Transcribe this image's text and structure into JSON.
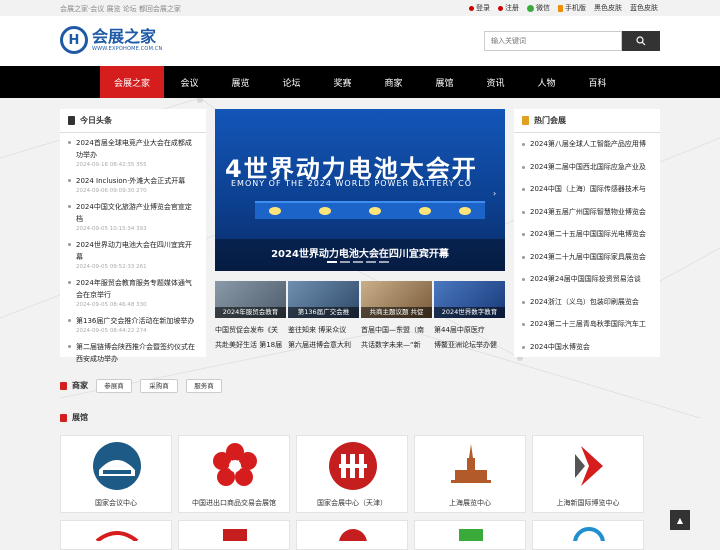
{
  "topbar": {
    "links": "会展之家·会议 展览 论坛 都回会展之家",
    "login": "登录",
    "register": "注册",
    "wechat": "微信",
    "mobile": "手机版",
    "black_skin": "黑色皮肤",
    "blue_skin": "蓝色皮肤"
  },
  "logo": {
    "cn": "会展之家",
    "en": "WWW.EXPOHOME.COM.CN",
    "mark": "H"
  },
  "search": {
    "placeholder": "输入关键词"
  },
  "nav": [
    "会展之家",
    "会议",
    "展览",
    "论坛",
    "奖赛",
    "商家",
    "展馆",
    "资讯",
    "人物",
    "百科"
  ],
  "news": {
    "title": "今日头条",
    "items": [
      {
        "t": "2024首届全球电竞产业大会在成都成功举办",
        "d": "2024-09-16 08:42:35    355"
      },
      {
        "t": "2024 Inclusion·外滩大会正式开幕",
        "d": "2024-09-06 09:09:30    270"
      },
      {
        "t": "2024中国文化旅游产业博览会官宣定档",
        "d": "2024-09-05 10:15:34    393"
      },
      {
        "t": "2024世界动力电池大会在四川宜宾开幕",
        "d": "2024-09-05 09:52:33    261"
      },
      {
        "t": "2024年服贸会教育服务专题媒体通气会在京举行",
        "d": "2024-09-05 08:46:48    330"
      },
      {
        "t": "第136届广交会推介活动在新加坡举办",
        "d": "2024-09-05 08:44:22    274"
      },
      {
        "t": "第二届链博会陕西推介会暨签约仪式在西安成功举办",
        "d": ""
      }
    ]
  },
  "banner": {
    "big": "4世界动力电池大会开",
    "sub": "EMONY OF THE 2024 WORLD POWER BATTERY CO",
    "caption": "2024世界动力电池大会在四川宜宾开幕"
  },
  "thumbs": [
    "2024年服贸会教育",
    "第136届广交会推",
    "共商主题议题 共促",
    "2024世界数字教育"
  ],
  "heads": [
    [
      "中国贸促会发布《关",
      "共赴美好生活 第18届"
    ],
    [
      "鉴往知来 博采众议",
      "第六届进博会意大利"
    ],
    [
      "首届中国—东盟（南",
      "共话数字未来—“新"
    ],
    [
      "第44届中原医疗",
      "博鳌亚洲论坛举办健"
    ]
  ],
  "hot": {
    "title": "热门会展",
    "items": [
      "2024第八届全球人工智能产品应用博",
      "2024第二届中国西北国际应急产业及",
      "2024中国（上海）国际传感器技术与",
      "2024第五届广州国际智慧物业博览会",
      "2024第二十五届中国国际光电博览会",
      "2024第二十九届中国国际家具展览会",
      "2024第24届中国国际投资贸易洽谈",
      "2024浙江（义乌）包装印刷展览会",
      "2024第二十三届青岛秋季国际汽车工",
      "2024中国水博览会"
    ]
  },
  "merchant": {
    "title": "商家",
    "tags": [
      "参展商",
      "采购商",
      "服务商"
    ]
  },
  "venue": {
    "title": "展馆",
    "items": [
      "国家会议中心",
      "中国进出口商品交易会展馆",
      "国家会展中心（天津）",
      "上海展览中心",
      "上海新国际博览中心"
    ]
  },
  "colors": {
    "accent": "#d61d1d",
    "brand": "#1f5aa6",
    "nav_bg": "#000000"
  }
}
